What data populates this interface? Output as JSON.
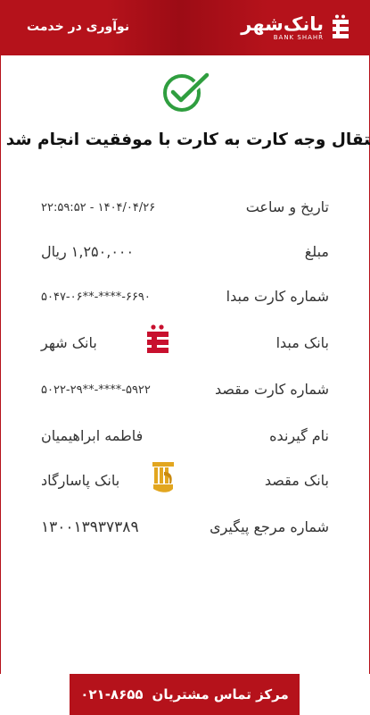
{
  "header": {
    "bank_name": "بانک‌شهر",
    "bank_name_en": "BANK SHAHR",
    "slogan": "نوآوری در خدمت"
  },
  "receipt": {
    "title": "انتقال وجه کارت به کارت با موفقیت انجام شد",
    "rows": [
      {
        "label": "تاریخ و ساعت",
        "value": "۲۲:۵۹:۵۲ - ۱۴۰۴/۰۴/۲۶"
      },
      {
        "label": "مبلغ",
        "value": "۱,۲۵۰,۰۰۰ ریال"
      },
      {
        "label": "شماره کارت مبدا",
        "value": "۵۰۴۷-۰۶**-****-۶۶۹۰"
      },
      {
        "label": "بانک مبدا",
        "value": "بانک شهر"
      },
      {
        "label": "شماره کارت مقصد",
        "value": "۵۰۲۲-۲۹**-****-۵۹۲۲"
      },
      {
        "label": "نام گیرنده",
        "value": "فاطمه ابراهیمیان"
      },
      {
        "label": "بانک مقصد",
        "value": "بانک پاسارگاد"
      },
      {
        "label": "شماره مرجع پیگیری",
        "value": "۱۳۰۰۱۳۹۳۷۳۸۹"
      }
    ]
  },
  "footer": {
    "label": "مرکز تماس مشتریان",
    "phone": "۰۲۱-۸۶۵۵"
  },
  "icons": {
    "status": "check-circle-icon",
    "source_bank": "bank-shahr-logo-icon",
    "dest_bank": "bank-pasargad-logo-icon"
  },
  "colors": {
    "brand_red": "#b5121b",
    "success_green": "#2f9e3f",
    "pasargad_gold": "#e2a61f"
  }
}
